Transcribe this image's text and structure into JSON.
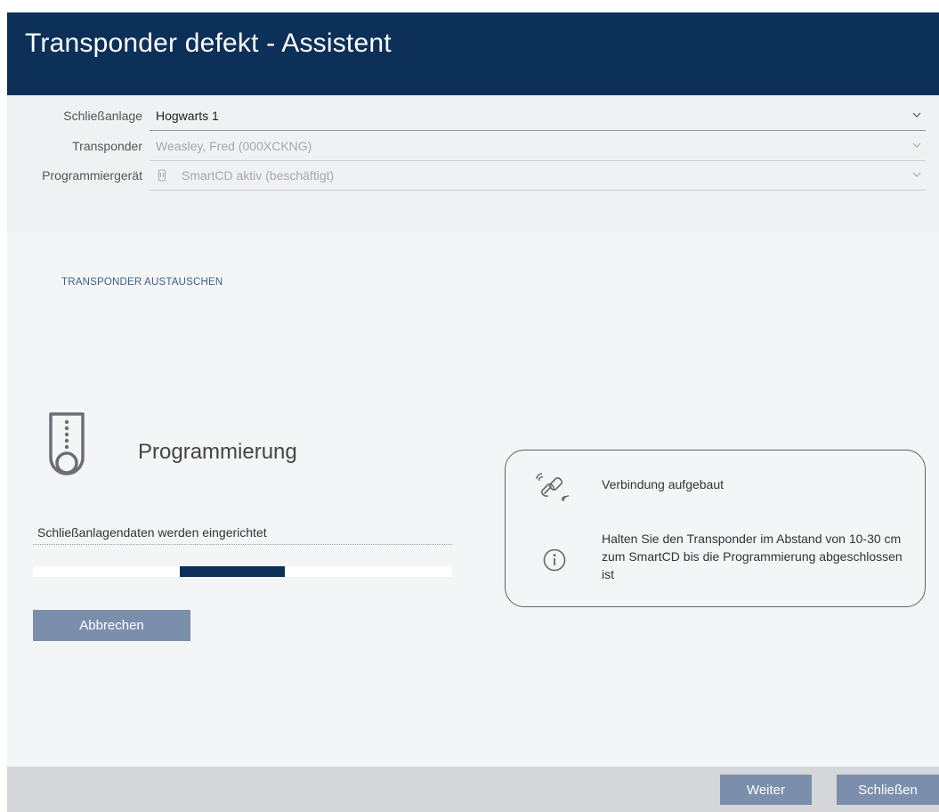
{
  "window": {
    "title": "Transponder defekt - Assistent"
  },
  "form": {
    "locking_system": {
      "label": "Schließanlage",
      "value": "Hogwarts 1"
    },
    "transponder": {
      "label": "Transponder",
      "value": "Weasley, Fred (000XCKNG)"
    },
    "programming_device": {
      "label": "Programmiergerät",
      "value": "SmartCD aktiv (beschäftigt)"
    }
  },
  "section": {
    "title": "TRANSPONDER AUSTAUSCHEN"
  },
  "programming": {
    "title": "Programmierung",
    "status": "Schließanlagendaten werden eingerichtet",
    "progress_indicator": {
      "start_fraction": 0.35,
      "end_fraction": 0.6
    },
    "cancel_label": "Abbrechen"
  },
  "info": {
    "connection_text": "Verbindung aufgebaut",
    "hint_text": "Halten Sie den Transponder im Abstand von 10-30 cm zum SmartCD bis die Programmierung abgeschlossen ist"
  },
  "footer": {
    "next_label": "Weiter",
    "close_label": "Schließen"
  },
  "colors": {
    "header": "#0d3058",
    "button": "#7b8fad",
    "progress": "#0d3058"
  },
  "icons": [
    "chevron-down-icon",
    "device-icon",
    "transponder-icon",
    "link-signal-icon",
    "info-icon"
  ]
}
